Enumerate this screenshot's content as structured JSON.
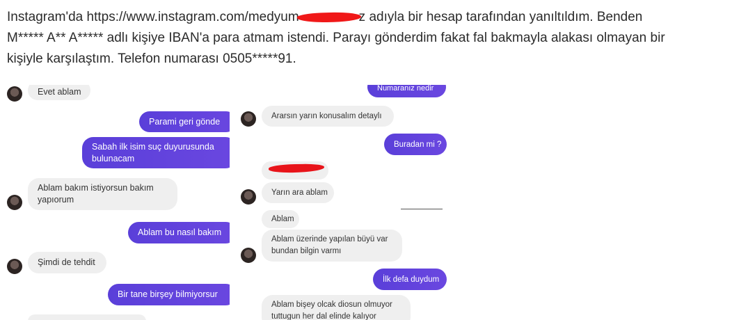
{
  "article": {
    "line1_pre": "Instagram'da https://www.instagram.com/medyum",
    "line1_post": "z adıyla bir hesap tarafından yanıltıldım. Benden",
    "line2": "M***** A** A***** adlı kişiye IBAN'a para atmam istendi. Parayı gönderdim fakat fal bakmayla alakası olmayan bir",
    "line3": "kişiyle karşılaştım. Telefon numarası 0505*****91."
  },
  "left_chat": {
    "messages": [
      {
        "from": "them",
        "text": "Evet ablam"
      },
      {
        "from": "me",
        "text": "Parami geri gönde"
      },
      {
        "from": "me",
        "line1": "Sabah ilk isim suç duyurusunda",
        "line2": "bulunacam"
      },
      {
        "from": "them",
        "line1": "Ablam bakım istiyorsun bakım",
        "line2": "yapıorum"
      },
      {
        "from": "me",
        "text": "Ablam bu nasıl bakım"
      },
      {
        "from": "them",
        "text": "Şimdi de tehdit"
      },
      {
        "from": "me",
        "text": "Bir tane birşey bilmiyorsur"
      }
    ]
  },
  "right_chat": {
    "messages": [
      {
        "from": "me",
        "text": "Numaranız nedir"
      },
      {
        "from": "them",
        "text": "Ararsın yarın konusalım detaylı"
      },
      {
        "from": "me",
        "text": "Buradan mi ?"
      },
      {
        "from": "them",
        "text": "Yarın ara ablam"
      },
      {
        "from": "them",
        "text": "Ablam"
      },
      {
        "from": "them",
        "line1": "Ablam  üzerinde yapılan büyü var",
        "line2": "bundan bilgin varmı"
      },
      {
        "from": "me",
        "text": "İlk defa duydum"
      },
      {
        "from": "them",
        "line1": "Ablam  bişey olcak diosun olmuyor",
        "line2": "tuttugun her dal elinde kalıyor"
      }
    ]
  }
}
